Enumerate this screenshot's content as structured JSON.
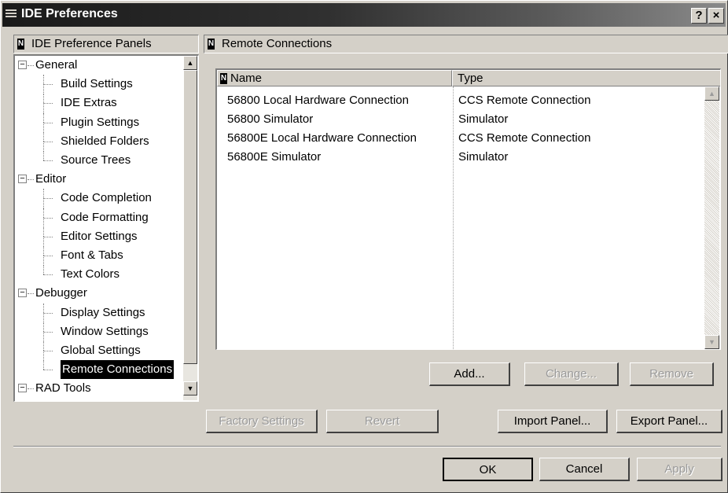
{
  "window": {
    "title": "IDE Preferences",
    "help_label": "?",
    "close_label": "×"
  },
  "left_panel": {
    "header": "IDE Preference Panels",
    "tree": [
      {
        "label": "General",
        "level": 0,
        "expanded": true
      },
      {
        "label": "Build Settings",
        "level": 1
      },
      {
        "label": "IDE Extras",
        "level": 1
      },
      {
        "label": "Plugin Settings",
        "level": 1
      },
      {
        "label": "Shielded Folders",
        "level": 1
      },
      {
        "label": "Source Trees",
        "level": 1
      },
      {
        "label": "Editor",
        "level": 0,
        "expanded": true
      },
      {
        "label": "Code Completion",
        "level": 1
      },
      {
        "label": "Code Formatting",
        "level": 1
      },
      {
        "label": "Editor Settings",
        "level": 1
      },
      {
        "label": "Font & Tabs",
        "level": 1
      },
      {
        "label": "Text Colors",
        "level": 1
      },
      {
        "label": "Debugger",
        "level": 0,
        "expanded": true
      },
      {
        "label": "Display Settings",
        "level": 1
      },
      {
        "label": "Window Settings",
        "level": 1
      },
      {
        "label": "Global Settings",
        "level": 1
      },
      {
        "label": "Remote Connections",
        "level": 1,
        "selected": true
      },
      {
        "label": "RAD Tools",
        "level": 0,
        "expanded": true
      }
    ]
  },
  "right_panel": {
    "header": "Remote Connections",
    "columns": {
      "name": "Name",
      "type": "Type"
    },
    "rows": [
      {
        "name": "56800 Local Hardware Connection",
        "type": "CCS Remote Connection"
      },
      {
        "name": "56800 Simulator",
        "type": "Simulator"
      },
      {
        "name": "56800E Local Hardware Connection",
        "type": "CCS Remote Connection"
      },
      {
        "name": "56800E Simulator",
        "type": "Simulator"
      }
    ],
    "buttons": {
      "add": "Add...",
      "change": "Change...",
      "remove": "Remove"
    }
  },
  "footer": {
    "factory_settings": "Factory Settings",
    "revert": "Revert",
    "import_panel": "Import Panel...",
    "export_panel": "Export Panel...",
    "ok": "OK",
    "cancel": "Cancel",
    "apply": "Apply"
  },
  "colors": {
    "face": "#d4d0c8",
    "selection": "#000000",
    "disabled_text": "#9a9a9a"
  }
}
